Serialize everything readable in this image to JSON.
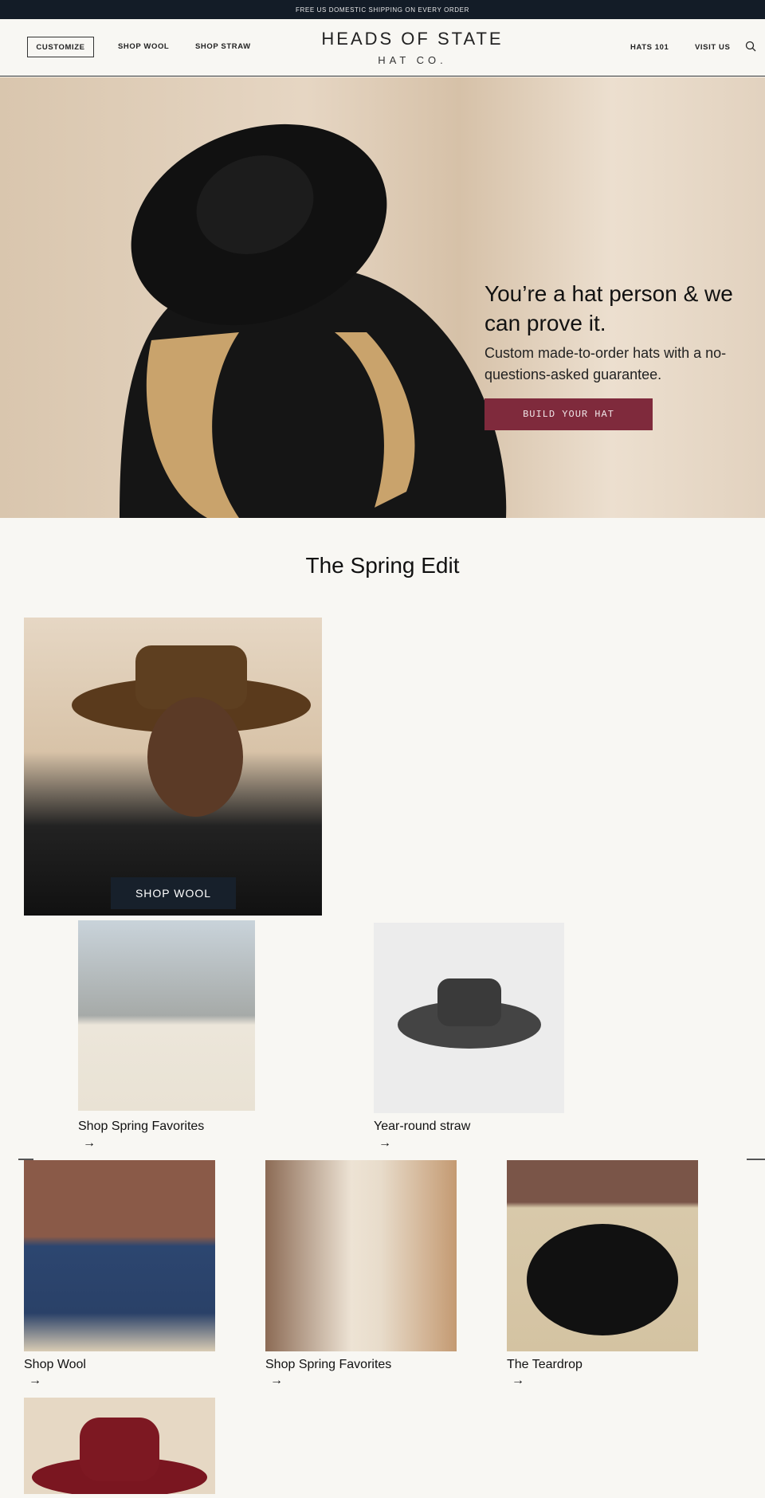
{
  "announcement": "FREE US DOMESTIC SHIPPING ON EVERY ORDER",
  "nav": {
    "customize": "CUSTOMIZE",
    "shop_wool": "SHOP WOOL",
    "shop_straw": "SHOP STRAW",
    "hats_101": "HATS 101",
    "visit_us": "VISIT US",
    "search_icon": "search-icon"
  },
  "logo": {
    "line1": "HEADS OF STATE",
    "line2": "HAT CO."
  },
  "hero": {
    "heading": "You’re a hat person & we can prove it.",
    "subheading": "Custom made-to-order hats with a no-questions-asked guarantee.",
    "button": "BUILD YOUR HAT",
    "button_color": "#7f2a3c"
  },
  "spring_edit": {
    "title": "The Spring Edit",
    "featured_button": "SHOP WOOL",
    "cards": [
      {
        "label": "Shop Spring Favorites"
      },
      {
        "label": "Year-round straw"
      },
      {
        "label": "Shop Wool"
      },
      {
        "label": "Shop Spring Favorites"
      },
      {
        "label": "The Teardrop"
      }
    ],
    "arrow": "→"
  }
}
